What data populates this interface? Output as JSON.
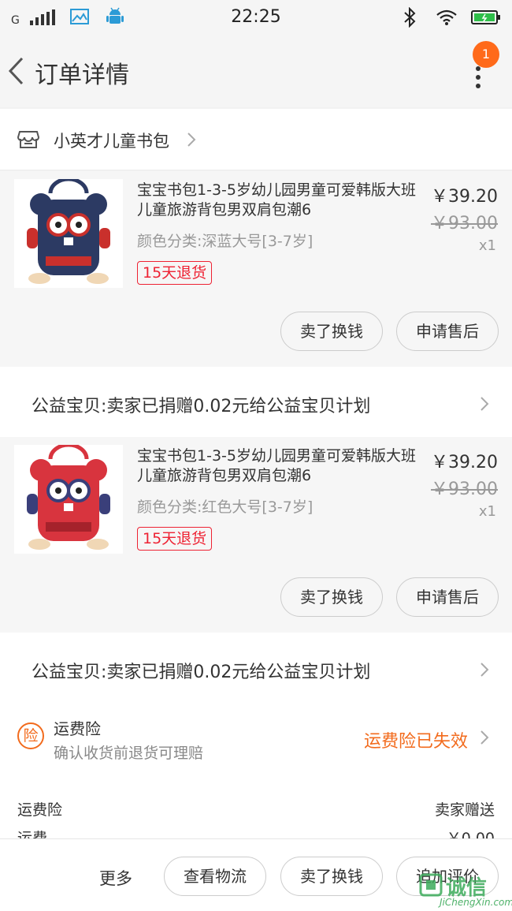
{
  "status_bar": {
    "carrier": "G",
    "time": "22:25"
  },
  "nav": {
    "title": "订单详情",
    "badge_count": "1"
  },
  "shop": {
    "name": "小英才儿童书包"
  },
  "items": [
    {
      "title": "宝宝书包1-3-5岁幼儿园男童可爱韩版大班儿童旅游背包男双肩包潮6",
      "sku": "颜色分类:深蓝大号[3-7岁]",
      "tag": "15天退货",
      "price": "￥39.20",
      "original_price": "￥93.00",
      "qty": "x1",
      "bag_color": "#2c3a63",
      "buttons": {
        "sell": "卖了换钱",
        "after_sale": "申请售后"
      }
    },
    {
      "title": "宝宝书包1-3-5岁幼儿园男童可爱韩版大班儿童旅游背包男双肩包潮6",
      "sku": "颜色分类:红色大号[3-7岁]",
      "tag": "15天退货",
      "price": "￥39.20",
      "original_price": "￥93.00",
      "qty": "x1",
      "bag_color": "#d8343e",
      "buttons": {
        "sell": "卖了换钱",
        "after_sale": "申请售后"
      }
    }
  ],
  "charity": "公益宝贝:卖家已捐赠0.02元给公益宝贝计划",
  "insurance": {
    "icon_char": "险",
    "title": "运费险",
    "subtitle": "确认收货前退货可理赔",
    "status": "运费险已失效"
  },
  "fees": [
    {
      "label": "运费险",
      "value": "卖家赠送"
    },
    {
      "label": "运费",
      "value": "￥0.00"
    }
  ],
  "bottom_bar": {
    "more": "更多",
    "logistics": "查看物流",
    "sell": "卖了换钱",
    "review": "追加评价"
  },
  "watermark": {
    "cn": "诚信",
    "en": "JiChengXin.com"
  },
  "colors": {
    "accent": "#f26b1d",
    "tag": "#ee2233",
    "badge": "#ff6a1a"
  }
}
